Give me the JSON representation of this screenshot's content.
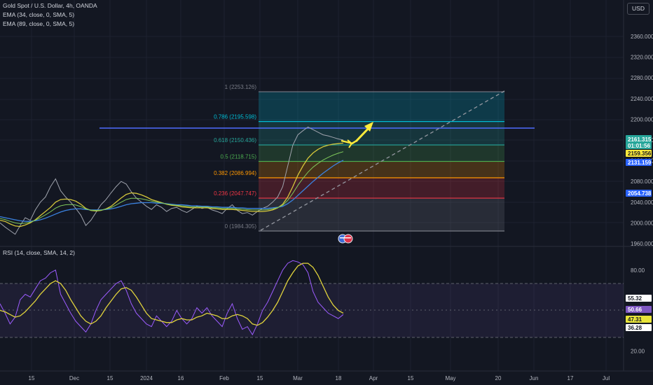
{
  "header": {
    "symbol_line": "Gold Spot / U.S. Dollar, 4h, OANDA",
    "ema1": "EMA (34, close, 0, SMA, 5)",
    "ema2": "EMA (89, close, 0, SMA, 5)",
    "currency": "USD"
  },
  "rsi_header": "RSI (14, close, SMA, 14, 2)",
  "colors": {
    "background": "#131722",
    "price_line": "#9fa3ad",
    "ema34": "#d4c63a",
    "ema89": "#3b82e0",
    "ema_mid": "#7ec85b",
    "resistance": "#4f6dff",
    "rsi": "#9c5cff",
    "rsi_ma": "#e0d33c",
    "arrow": "#ffeb3b"
  },
  "chart_data": [
    {
      "type": "line",
      "title": "Gold Spot / U.S. Dollar, 4h, OANDA",
      "ylim": [
        1960,
        2370
      ],
      "y_ticks": [
        "2360.000",
        "2320.000",
        "2280.000",
        "2240.000",
        "2200.000",
        "2160.000",
        "2120.000",
        "2080.000",
        "2040.000",
        "2000.000",
        "1960.000"
      ],
      "x_ticks": [
        "15",
        "Dec",
        "15",
        "2024",
        "16",
        "Feb",
        "15",
        "Mar",
        "18",
        "Apr",
        "15",
        "May",
        "20",
        "Jun",
        "17",
        "Jul"
      ],
      "series": [
        {
          "name": "price",
          "values": [
            2000,
            1992,
            1985,
            1978,
            1995,
            2010,
            2005,
            2025,
            2040,
            2050,
            2070,
            2085,
            2062,
            2050,
            2040,
            2028,
            2015,
            1995,
            2005,
            2020,
            2035,
            2045,
            2058,
            2070,
            2080,
            2075,
            2060,
            2048,
            2040,
            2032,
            2026,
            2035,
            2030,
            2022,
            2028,
            2030,
            2024,
            2020,
            2026,
            2032,
            2028,
            2030,
            2025,
            2022,
            2018,
            2028,
            2035,
            2024,
            2018,
            2020,
            2015,
            2022,
            2028,
            2032,
            2040,
            2050,
            2070,
            2110,
            2150,
            2170,
            2178,
            2185,
            2180,
            2175,
            2170,
            2168,
            2165,
            2162,
            2160
          ]
        },
        {
          "name": "ema34",
          "values": [
            2005,
            2003,
            1998,
            1994,
            1993,
            1996,
            2000,
            2006,
            2014,
            2022,
            2030,
            2040,
            2045,
            2046,
            2045,
            2042,
            2036,
            2028,
            2024,
            2023,
            2024,
            2027,
            2032,
            2040,
            2048,
            2055,
            2058,
            2057,
            2054,
            2050,
            2045,
            2042,
            2039,
            2036,
            2034,
            2033,
            2031,
            2030,
            2029,
            2029,
            2029,
            2029,
            2028,
            2027,
            2026,
            2026,
            2026,
            2025,
            2024,
            2023,
            2022,
            2022,
            2022,
            2023,
            2025,
            2029,
            2036,
            2050,
            2070,
            2092,
            2110,
            2125,
            2135,
            2142,
            2147,
            2150,
            2152,
            2153,
            2154
          ]
        },
        {
          "name": "ema89",
          "values": [
            2012,
            2010,
            2008,
            2006,
            2004,
            2003,
            2003,
            2004,
            2006,
            2009,
            2013,
            2017,
            2021,
            2024,
            2026,
            2027,
            2027,
            2026,
            2025,
            2025,
            2025,
            2026,
            2027,
            2029,
            2032,
            2035,
            2037,
            2038,
            2039,
            2039,
            2039,
            2038,
            2038,
            2037,
            2036,
            2035,
            2035,
            2034,
            2033,
            2033,
            2032,
            2032,
            2031,
            2031,
            2030,
            2030,
            2030,
            2029,
            2029,
            2028,
            2028,
            2028,
            2028,
            2028,
            2029,
            2030,
            2032,
            2037,
            2044,
            2053,
            2062,
            2071,
            2080,
            2088,
            2096,
            2103,
            2110,
            2116,
            2121
          ]
        }
      ],
      "last_price": {
        "label": "2161.315",
        "sub": "01:01:56"
      },
      "price_tags": [
        "2159.356",
        "2131.159",
        "2054.738"
      ]
    },
    {
      "type": "line",
      "title": "RSI (14, close, SMA, 14, 2)",
      "ylim": [
        15,
        90
      ],
      "y_ticks": [
        "80.00",
        "20.00"
      ],
      "levels": {
        "upper": 70,
        "middle": 50,
        "lower": 30
      },
      "series": [
        {
          "name": "rsi",
          "values": [
            55,
            48,
            40,
            45,
            58,
            62,
            60,
            66,
            72,
            74,
            78,
            80,
            62,
            55,
            48,
            42,
            38,
            34,
            40,
            50,
            58,
            62,
            66,
            70,
            72,
            65,
            55,
            48,
            44,
            40,
            38,
            46,
            42,
            38,
            42,
            50,
            44,
            40,
            44,
            52,
            48,
            52,
            46,
            42,
            38,
            48,
            55,
            44,
            36,
            38,
            32,
            40,
            50,
            56,
            64,
            72,
            80,
            85,
            87,
            86,
            84,
            78,
            64,
            56,
            52,
            48,
            46,
            44,
            47
          ]
        },
        {
          "name": "rsi_ma",
          "values": [
            50,
            49,
            47,
            45,
            46,
            49,
            53,
            57,
            62,
            66,
            70,
            72,
            70,
            65,
            58,
            52,
            46,
            42,
            40,
            42,
            46,
            52,
            57,
            62,
            66,
            67,
            65,
            60,
            54,
            48,
            44,
            43,
            42,
            41,
            41,
            43,
            44,
            43,
            43,
            45,
            46,
            48,
            47,
            46,
            44,
            44,
            46,
            47,
            46,
            44,
            40,
            39,
            41,
            45,
            50,
            56,
            64,
            72,
            78,
            83,
            85,
            85,
            82,
            76,
            68,
            60,
            54,
            50,
            48
          ]
        }
      ],
      "value_tags": [
        "55.32",
        "50.66",
        "47.31",
        "36.28"
      ]
    }
  ],
  "fibonacci": [
    {
      "label": "1 (2253.126)",
      "price": 2253.126,
      "color": "#787b86"
    },
    {
      "label": "0.786 (2195.598)",
      "price": 2195.598,
      "color": "#00bcd4"
    },
    {
      "label": "0.618 (2150.436)",
      "price": 2150.436,
      "color": "#26a69a"
    },
    {
      "label": "0.5 (2118.715)",
      "price": 2118.715,
      "color": "#4caf50"
    },
    {
      "label": "0.382 (2086.994)",
      "price": 2086.994,
      "color": "#ff9800"
    },
    {
      "label": "0.236 (2047.747)",
      "price": 2047.747,
      "color": "#f23645"
    },
    {
      "label": "0 (1984.305)",
      "price": 1984.305,
      "color": "#787b86"
    }
  ]
}
